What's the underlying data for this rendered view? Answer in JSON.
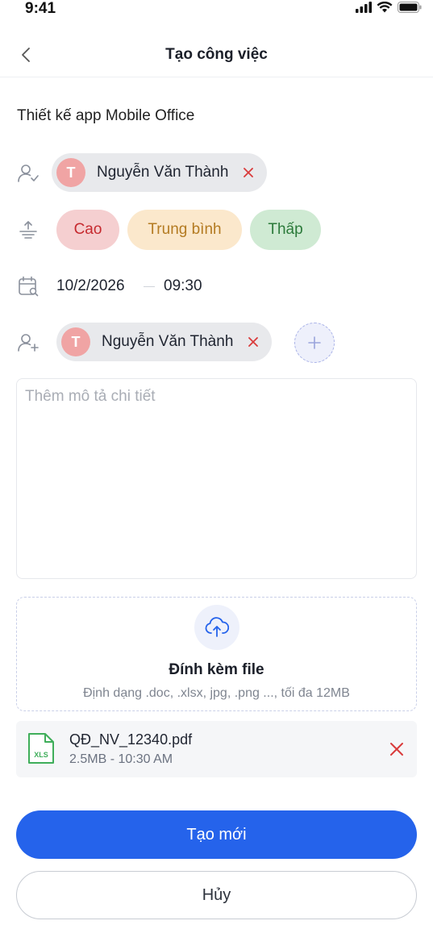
{
  "status_bar": {
    "time": "9:41"
  },
  "header": {
    "title": "Tạo công việc"
  },
  "task": {
    "title": "Thiết kế app Mobile Office"
  },
  "assignee": {
    "initial": "T",
    "name": "Nguyễn Văn Thành"
  },
  "priority": {
    "high": "Cao",
    "medium": "Trung bình",
    "low": "Thấp"
  },
  "schedule": {
    "date": "10/2/2026",
    "time": "09:30"
  },
  "followers": [
    {
      "initial": "T",
      "name": "Nguyễn Văn Thành"
    }
  ],
  "description": {
    "placeholder": "Thêm mô tả chi tiết",
    "value": ""
  },
  "upload": {
    "title": "Đính kèm file",
    "subtitle": "Định dạng .doc, .xlsx, jpg, .png ..., tối đa 12MB"
  },
  "attachments": [
    {
      "name": "QĐ_NV_12340.pdf",
      "meta": "2.5MB - 10:30 AM",
      "icon_label": "XLS"
    }
  ],
  "actions": {
    "create_label": "Tạo mới",
    "cancel_label": "Hủy"
  },
  "colors": {
    "primary": "#2563eb",
    "high_bg": "#f5cfd0",
    "high_fg": "#c62a2f",
    "medium_bg": "#fbe8cc",
    "medium_fg": "#b47b22",
    "low_bg": "#cfead3",
    "low_fg": "#2b7a3a",
    "remove": "#d93b3b",
    "avatar": "#f0a4a4",
    "file_icon": "#3fae5a"
  }
}
